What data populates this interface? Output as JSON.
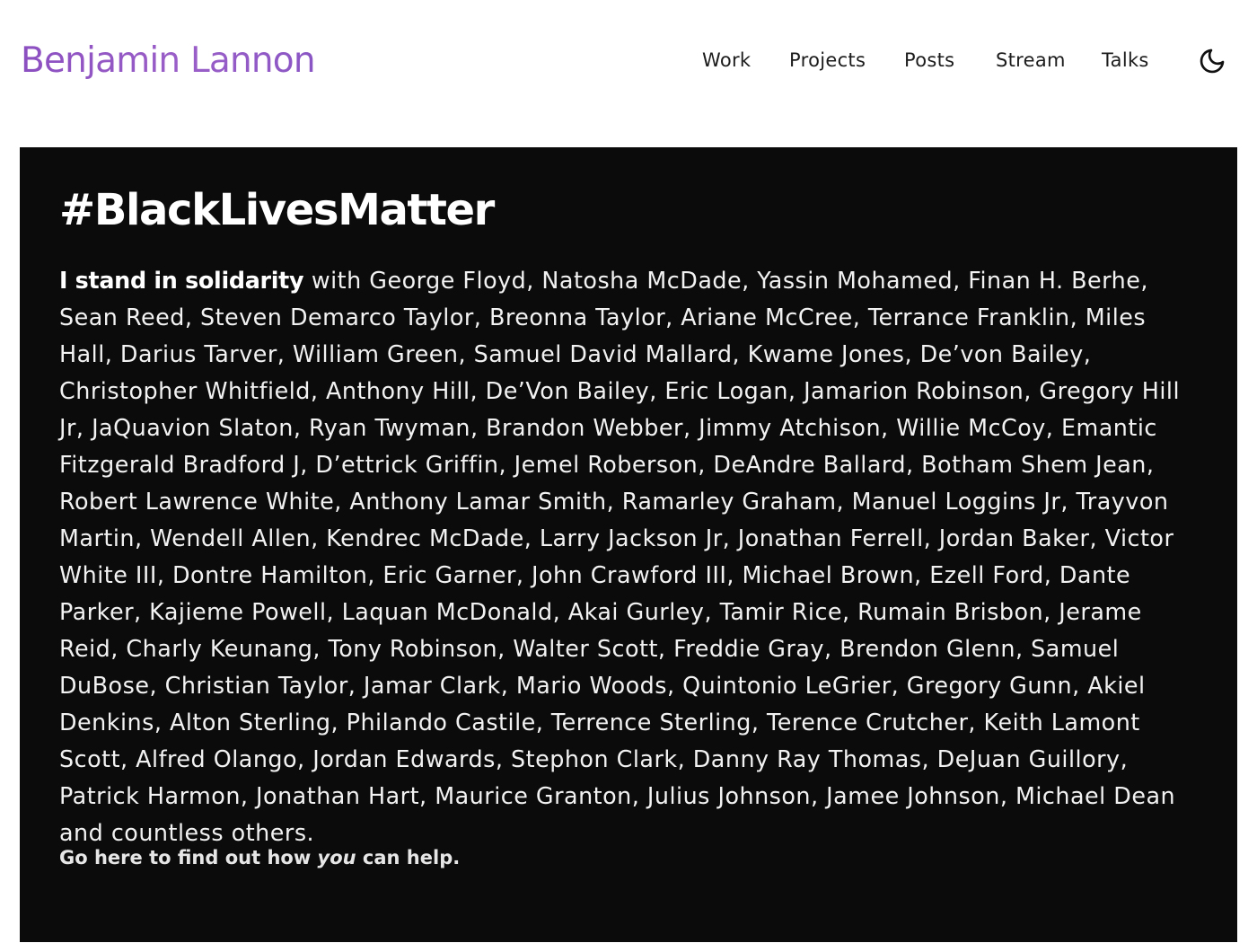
{
  "site": {
    "brand": "Benjamin Lannon"
  },
  "nav": {
    "items": [
      {
        "label": "Work"
      },
      {
        "label": "Projects"
      },
      {
        "label": "Posts"
      },
      {
        "label": "Stream"
      },
      {
        "label": "Talks"
      }
    ],
    "theme_toggle_icon": "moon-icon"
  },
  "blm": {
    "title": "#BlackLivesMatter",
    "lead": "I stand in solidarity",
    "body": " with George Floyd, Natosha McDade, Yassin Mohamed, Finan H. Berhe, Sean Reed, Steven Demarco Taylor, Breonna Taylor, Ariane McCree, Terrance Franklin, Miles Hall, Darius Tarver, William Green, Samuel David Mallard, Kwame Jones, De’von Bailey, Christopher Whitfield, Anthony Hill, De’Von Bailey, Eric Logan, Jamarion Robinson, Gregory Hill Jr, JaQuavion Slaton, Ryan Twyman, Brandon Webber, Jimmy Atchison, Willie McCoy, Emantic Fitzgerald Bradford J, D’ettrick Griffin, Jemel Roberson, DeAndre Ballard, Botham Shem Jean, Robert Lawrence White, Anthony Lamar Smith, Ramarley Graham, Manuel Loggins Jr, Trayvon Martin, Wendell Allen, Kendrec McDade, Larry Jackson Jr, Jonathan Ferrell, Jordan Baker, Victor White III, Dontre Hamilton, Eric Garner, John Crawford III, Michael Brown, Ezell Ford, Dante Parker, Kajieme Powell, Laquan McDonald, Akai Gurley, Tamir Rice, Rumain Brisbon, Jerame Reid, Charly Keunang, Tony Robinson, Walter Scott, Freddie Gray, Brendon Glenn, Samuel DuBose, Christian Taylor, Jamar Clark, Mario Woods, Quintonio LeGrier, Gregory Gunn, Akiel Denkins, Alton Sterling, Philando Castile, Terrence Sterling, Terence Crutcher, Keith Lamont Scott, Alfred Olango, Jordan Edwards, Stephon Clark, Danny Ray Thomas, DeJuan Guillory, Patrick Harmon, Jonathan Hart, Maurice Granton, Julius Johnson, Jamee Johnson, Michael Dean and countless others.",
    "help_prefix": "Go here to find out how ",
    "help_emphasis": "you",
    "help_suffix": " can help."
  },
  "colors": {
    "brand_gradient_start": "#8c4fc0",
    "brand_gradient_end": "#8a56c4",
    "banner_background": "#0b0b0b",
    "page_background": "#ffffff"
  }
}
